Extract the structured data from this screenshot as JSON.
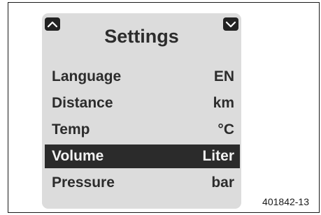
{
  "screen": {
    "title": "Settings",
    "rows": [
      {
        "label": "Language",
        "value": "EN",
        "selected": false
      },
      {
        "label": "Distance",
        "value": "km",
        "selected": false
      },
      {
        "label": "Temp",
        "value": "°C",
        "selected": false
      },
      {
        "label": "Volume",
        "value": "Liter",
        "selected": true
      },
      {
        "label": "Pressure",
        "value": "bar",
        "selected": false
      }
    ],
    "nav": {
      "up_icon": "chevron-up-icon",
      "down_icon": "chevron-down-icon"
    }
  },
  "figure_ref": "401842-13",
  "colors": {
    "screen_bg": "#dcdcdc",
    "highlight_bg": "#2b2b2b",
    "text": "#2c2c2c",
    "highlight_text": "#f2f2f2"
  }
}
